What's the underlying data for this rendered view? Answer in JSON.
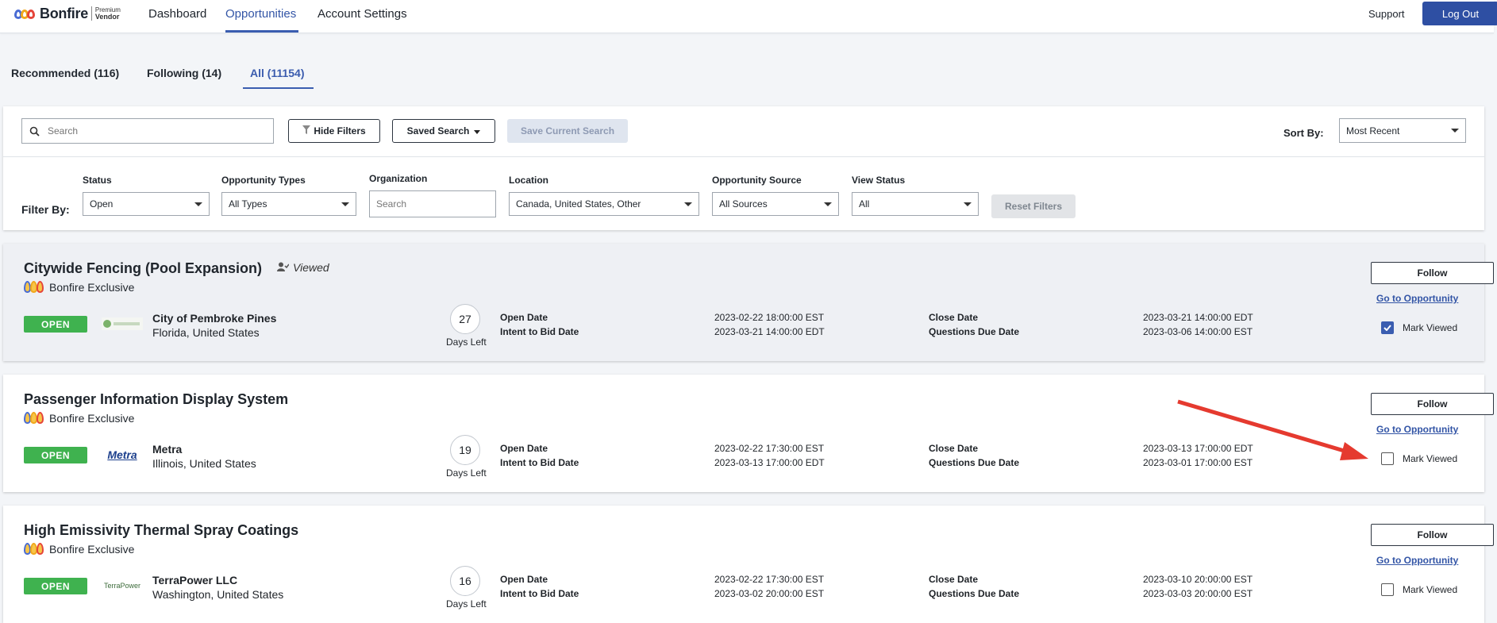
{
  "nav": {
    "logo_text": "Bonfire",
    "logo_sub1": "Premium",
    "logo_sub2": "Vendor",
    "links": [
      "Dashboard",
      "Opportunities",
      "Account Settings"
    ],
    "support": "Support",
    "logout": "Log Out"
  },
  "tabs": [
    "Recommended (116)",
    "Following (14)",
    "All (11154)"
  ],
  "search": {
    "placeholder": "Search",
    "hide_filters": "Hide Filters",
    "saved_search": "Saved Search",
    "save_current": "Save Current Search",
    "sort_label": "Sort By:",
    "sort_value": "Most Recent"
  },
  "filters": {
    "filter_by": "Filter By:",
    "status_label": "Status",
    "status_value": "Open",
    "types_label": "Opportunity Types",
    "types_value": "All Types",
    "org_label": "Organization",
    "org_placeholder": "Search",
    "location_label": "Location",
    "location_value": "Canada, United States, Other",
    "source_label": "Opportunity Source",
    "source_value": "All Sources",
    "view_label": "View Status",
    "view_value": "All",
    "reset": "Reset Filters"
  },
  "card_common": {
    "exclusive": "Bonfire Exclusive",
    "open_badge": "OPEN",
    "days_left": "Days Left",
    "open_date_label": "Open Date",
    "intent_label": "Intent to Bid Date",
    "close_date_label": "Close Date",
    "questions_label": "Questions Due Date",
    "follow": "Follow",
    "goto": "Go to Opportunity",
    "mark_viewed": "Mark Viewed",
    "viewed_tag": "Viewed"
  },
  "cards": [
    {
      "title": "Citywide Fencing (Pool Expansion)",
      "org": "City of Pembroke Pines",
      "location": "Florida, United States",
      "org_logo": "",
      "days": "27",
      "open_date": "2023-02-22 18:00:00 EST",
      "intent_date": "2023-03-21 14:00:00 EDT",
      "close_date": "2023-03-21 14:00:00 EDT",
      "questions_date": "2023-03-06 14:00:00 EST",
      "checked": true
    },
    {
      "title": "Passenger Information Display System",
      "org": "Metra",
      "location": "Illinois, United States",
      "org_logo": "Metra",
      "days": "19",
      "open_date": "2023-02-22 17:30:00 EST",
      "intent_date": "2023-03-13 17:00:00 EDT",
      "close_date": "2023-03-13 17:00:00 EDT",
      "questions_date": "2023-03-01 17:00:00 EST",
      "checked": false
    },
    {
      "title": "High Emissivity Thermal Spray Coatings",
      "org": "TerraPower LLC",
      "location": "Washington, United States",
      "org_logo": "TerraPower",
      "days": "16",
      "open_date": "2023-02-22 17:30:00 EST",
      "intent_date": "2023-03-02 20:00:00 EST",
      "close_date": "2023-03-10 20:00:00 EST",
      "questions_date": "2023-03-03 20:00:00 EST",
      "checked": false
    }
  ],
  "colors": {
    "accent": "#3a5db0",
    "open_green": "#3fb24f",
    "arrow_red": "#e53a2f"
  }
}
